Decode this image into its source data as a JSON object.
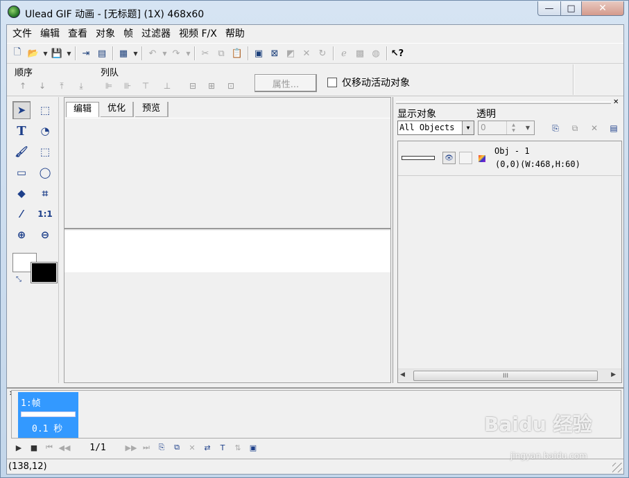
{
  "window": {
    "title": "Ulead GIF 动画 - [无标题] (1X) 468x60",
    "controls": {
      "minimize": "—",
      "maximize": "□",
      "close": "✕"
    }
  },
  "menu": [
    "文件",
    "编辑",
    "查看",
    "对象",
    "帧",
    "过滤器",
    "视频 F/X",
    "帮助"
  ],
  "toolbar": {
    "icons": [
      "new-icon",
      "open-icon",
      "save-icon",
      "add-image-icon",
      "add-video-icon",
      "optimize-icon",
      "undo-icon",
      "redo-icon",
      "cut-icon",
      "copy-icon",
      "paste-icon",
      "frame-icon",
      "delete-frame-icon",
      "properties-icon",
      "crop-icon",
      "rotate-icon",
      "browser-icon",
      "sequence-icon",
      "help-icon"
    ]
  },
  "objbar": {
    "order_label": "顺序",
    "align_label": "列队",
    "properties_button": "属性...",
    "move_active_label": "仅移动活动对象"
  },
  "tools": [
    "pick-tool-icon",
    "marquee-tool-icon",
    "text-tool-icon",
    "lasso-tool-icon",
    "brush-tool-icon",
    "magic-wand-icon",
    "eraser-tool-icon",
    "ellipse-tool-icon",
    "fill-tool-icon",
    "transform-tool-icon",
    "eyedropper-icon",
    "actual-size-icon",
    "zoom-in-icon",
    "zoom-out-icon"
  ],
  "tools_text": {
    "text": "T",
    "actual": "1:1"
  },
  "colors": {
    "foreground": "#000000",
    "background": "#ffffff",
    "frame_selected": "#3399ff"
  },
  "tabs": [
    "编辑",
    "优化",
    "预览"
  ],
  "active_tab": "编辑",
  "objpanel": {
    "show_label": "显示对象",
    "transparency_label": "透明",
    "show_value": "All Objects",
    "transparency_value": "0",
    "objects": [
      {
        "name": "Obj - 1",
        "geometry": "(0,0)(W:468,H:60)"
      }
    ],
    "scroll_label": "III"
  },
  "frames": [
    {
      "label": "1:帧",
      "delay": "0.1 秒"
    }
  ],
  "frame_counter": "1/1",
  "status": {
    "coordinates": "(138,12)"
  },
  "watermark": {
    "brand": "Baidu 经验",
    "url": "jingyan.baidu.com"
  }
}
